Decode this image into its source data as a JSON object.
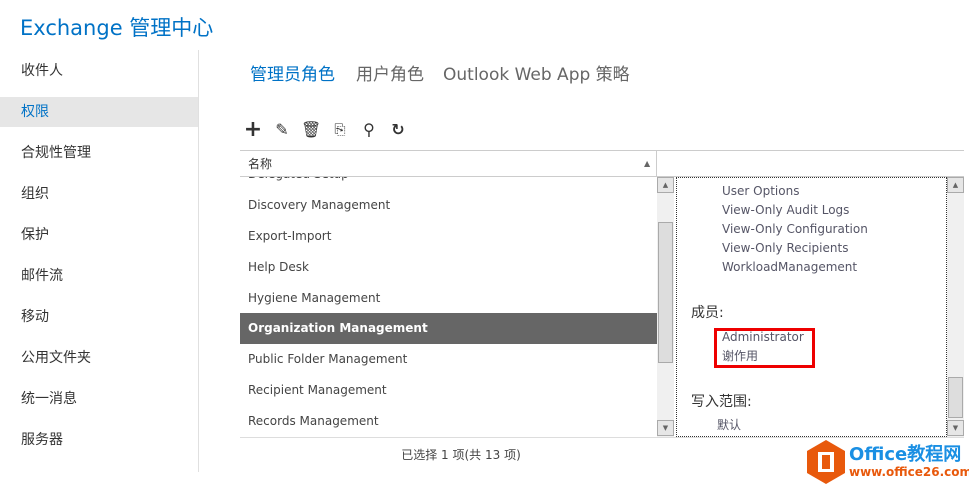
{
  "app_title": "Exchange 管理中心",
  "nav": [
    "收件人",
    "权限",
    "合规性管理",
    "组织",
    "保护",
    "邮件流",
    "移动",
    "公用文件夹",
    "统一消息",
    "服务器"
  ],
  "nav_selected": 1,
  "tabs": [
    "管理员角色",
    "用户角色",
    "Outlook Web App 策略"
  ],
  "toolbar": {
    "add": "add-icon",
    "edit": "edit-icon",
    "delete": "delete-icon",
    "copy": "copy-icon",
    "search": "search-icon",
    "refresh": "refresh-icon"
  },
  "list": {
    "header": "名称",
    "rows": [
      "Delegated Setup",
      "Discovery Management",
      "Export-Import",
      "Help Desk",
      "Hygiene Management",
      "Organization Management",
      "Public Folder Management",
      "Recipient Management",
      "Records Management"
    ],
    "selected": 5
  },
  "detail": {
    "roles": [
      "User Options",
      "View-Only Audit Logs",
      "View-Only Configuration",
      "View-Only Recipients",
      "WorkloadManagement"
    ],
    "members_label": "成员:",
    "members": [
      "Administrator",
      "谢作用"
    ],
    "scope_label": "写入范围:",
    "scope": "默认"
  },
  "footer": "已选择 1 项(共 13 项)",
  "watermark": {
    "title": "Office教程网",
    "url": "www.office26.com"
  },
  "colors": {
    "accent": "#0072c6",
    "selected_row": "#666666",
    "highlight": "#ee0000"
  }
}
